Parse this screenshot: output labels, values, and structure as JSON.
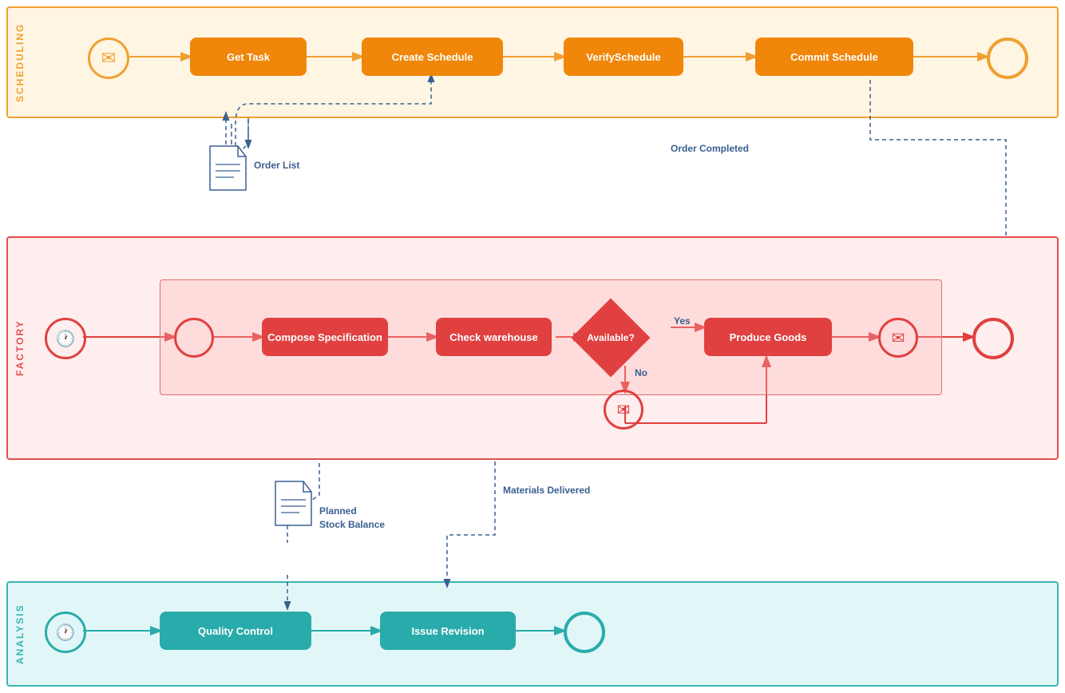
{
  "lanes": {
    "scheduling": {
      "label": "SCHEDULING",
      "color": "#f0a030",
      "bg": "rgba(255,235,200,0.5)"
    },
    "factory": {
      "label": "FACTORY",
      "color": "#e05050",
      "bg": "rgba(255,200,200,0.3)"
    },
    "analysis": {
      "label": "ANALYSIS",
      "color": "#3ab5b5",
      "bg": "rgba(180,235,235,0.4)"
    }
  },
  "nodes": {
    "get_task": "Get Task",
    "create_schedule": "Create Schedule",
    "verify_schedule": "VerifySchedule",
    "commit_schedule": "Commit Schedule",
    "compose_spec": "Compose Specification",
    "check_warehouse": "Check warehouse",
    "available": "Available?",
    "produce_goods": "Produce Goods",
    "quality_control": "Quality Control",
    "issue_revision": "Issue Revision",
    "order_list": "Order List",
    "planned_stock": "Planned\nStock Balance",
    "order_completed": "Order Completed",
    "materials_delivered": "Materials Delivered",
    "yes_label": "Yes",
    "no_label": "No"
  }
}
